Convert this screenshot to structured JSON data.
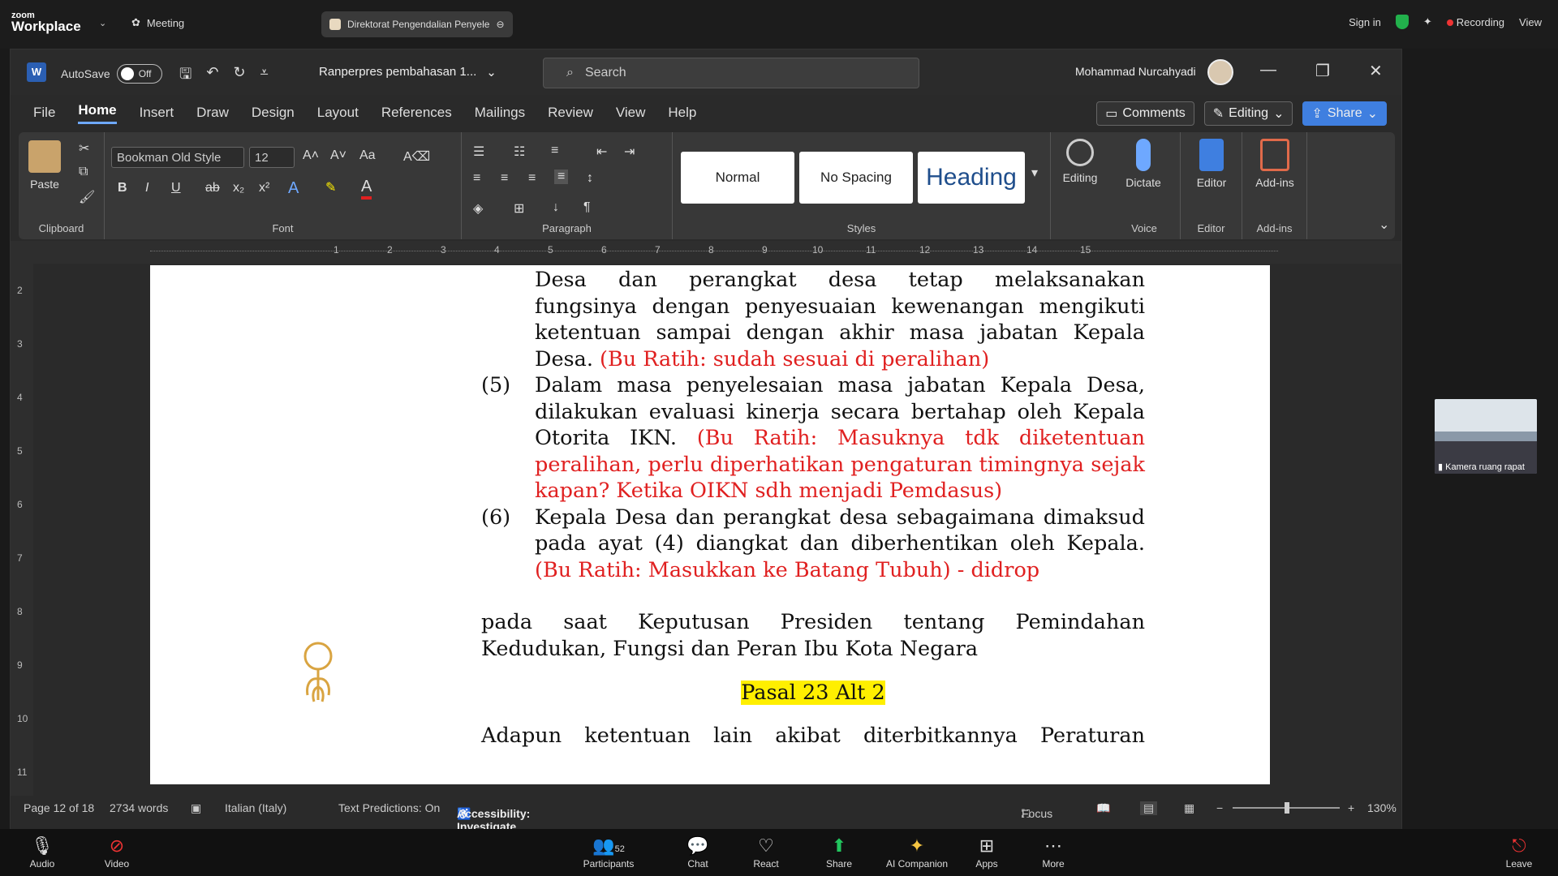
{
  "zoom": {
    "logo_small": "zoom",
    "logo_big": "Workplace",
    "meeting": "Meeting",
    "tab": "Direktorat Pengendalian Penyele",
    "sign_in": "Sign in",
    "recording": "Recording",
    "view": "View"
  },
  "word": {
    "autosave": "AutoSave",
    "toggle": "Off",
    "doc_title": "Ranperpres pembahasan 1...",
    "search": "Search",
    "user": "Mohammad Nurcahyadi"
  },
  "menu": [
    "File",
    "Home",
    "Insert",
    "Draw",
    "Design",
    "Layout",
    "References",
    "Mailings",
    "Review",
    "View",
    "Help"
  ],
  "menu_buttons": {
    "comments": "Comments",
    "editing": "Editing",
    "share": "Share"
  },
  "ribbon": {
    "paste": "Paste",
    "clipboard": "Clipboard",
    "font_name": "Bookman Old Style",
    "font_size": "12",
    "font": "Font",
    "paragraph": "Paragraph",
    "styles_label": "Styles",
    "styles": [
      "Normal",
      "No Spacing",
      "Heading"
    ],
    "editing": "Editing",
    "dictate": "Dictate",
    "voice": "Voice",
    "editor": "Editor",
    "editor_group": "Editor",
    "addins": "Add-ins",
    "addins_group": "Add-ins"
  },
  "document": {
    "p4_lines": [
      "Desa dan perangkat desa tetap melaksanakan",
      "fungsinya dengan penyesuaian kewenangan mengikuti",
      "ketentuan sampai dengan akhir masa jabatan Kepala"
    ],
    "p4_end": "Desa.",
    "p4_note": "(Bu Ratih: sudah sesuai di peralihan)",
    "p5_num": "(5)",
    "p5_text": "Dalam masa penyelesaian masa jabatan Kepala Desa, dilakukan evaluasi kinerja secara bertahap oleh Kepala Otorita IKN.",
    "p5_note": "(Bu Ratih: Masuknya tdk diketentuan peralihan, perlu diperhatikan pengaturan timingnya sejak kapan? Ketika OIKN sdh menjadi Pemdasus)",
    "p6_num": "(6)",
    "p6_text": "Kepala Desa dan perangkat desa sebagaimana dimaksud pada ayat (4) diangkat dan diberhentikan oleh Kepala.",
    "p6_note": "(Bu Ratih: Masukkan ke Batang Tubuh) - didrop",
    "para": "pada saat Keputusan Presiden tentang Pemindahan Kedudukan, Fungsi dan Peran Ibu Kota Negara",
    "heading": "Pasal 23 Alt 2",
    "cut_line": "Adapun ketentuan lain akibat diterbitkannya Peraturan"
  },
  "status": {
    "page": "Page 12 of 18",
    "words": "2734 words",
    "lang": "Italian (Italy)",
    "pred": "Text Predictions: On",
    "access": "Accessibility: Investigate",
    "focus": "Focus",
    "zoom": "130%"
  },
  "camera": "Kamera ruang rapat",
  "footer": {
    "audio": "Audio",
    "video": "Video",
    "participants": "Participants",
    "count": "52",
    "chat": "Chat",
    "react": "React",
    "share": "Share",
    "ai": "AI Companion",
    "apps": "Apps",
    "more": "More",
    "leave": "Leave"
  },
  "ruler_h": [
    "1",
    "2",
    "3",
    "4",
    "5",
    "6",
    "7",
    "8",
    "9",
    "10",
    "11",
    "12",
    "13",
    "14",
    "15"
  ],
  "ruler_v": [
    "2",
    "3",
    "4",
    "5",
    "6",
    "7",
    "8",
    "9",
    "10",
    "11"
  ]
}
